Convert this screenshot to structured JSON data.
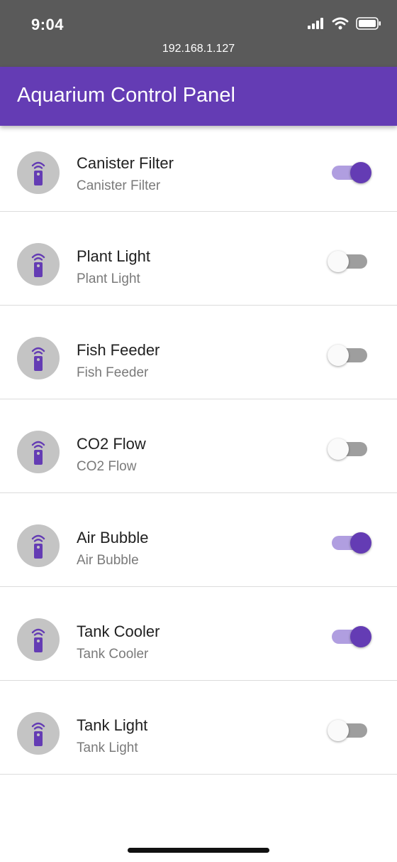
{
  "status_bar": {
    "time": "9:04",
    "url": "192.168.1.127",
    "icons": [
      "cellular-signal-icon",
      "wifi-icon",
      "battery-icon"
    ]
  },
  "app_bar": {
    "title": "Aquarium Control Panel",
    "color": "#643cb4"
  },
  "devices": [
    {
      "title": "Canister Filter",
      "subtitle": "Canister Filter",
      "on": true
    },
    {
      "title": "Plant Light",
      "subtitle": "Plant Light",
      "on": false
    },
    {
      "title": "Fish Feeder",
      "subtitle": "Fish Feeder",
      "on": false
    },
    {
      "title": "CO2 Flow",
      "subtitle": "CO2 Flow",
      "on": false
    },
    {
      "title": "Air Bubble",
      "subtitle": "Air Bubble",
      "on": true
    },
    {
      "title": "Tank Cooler",
      "subtitle": "Tank Cooler",
      "on": true
    },
    {
      "title": "Tank Light",
      "subtitle": "Tank Light",
      "on": false
    }
  ],
  "device_icon": "remote-control-icon",
  "colors": {
    "accent": "#643cb4",
    "track_on": "#b09ee0",
    "track_off": "#9e9e9e",
    "avatar_bg": "#c4c4c4",
    "status_bar_bg": "#5a5a5a"
  }
}
